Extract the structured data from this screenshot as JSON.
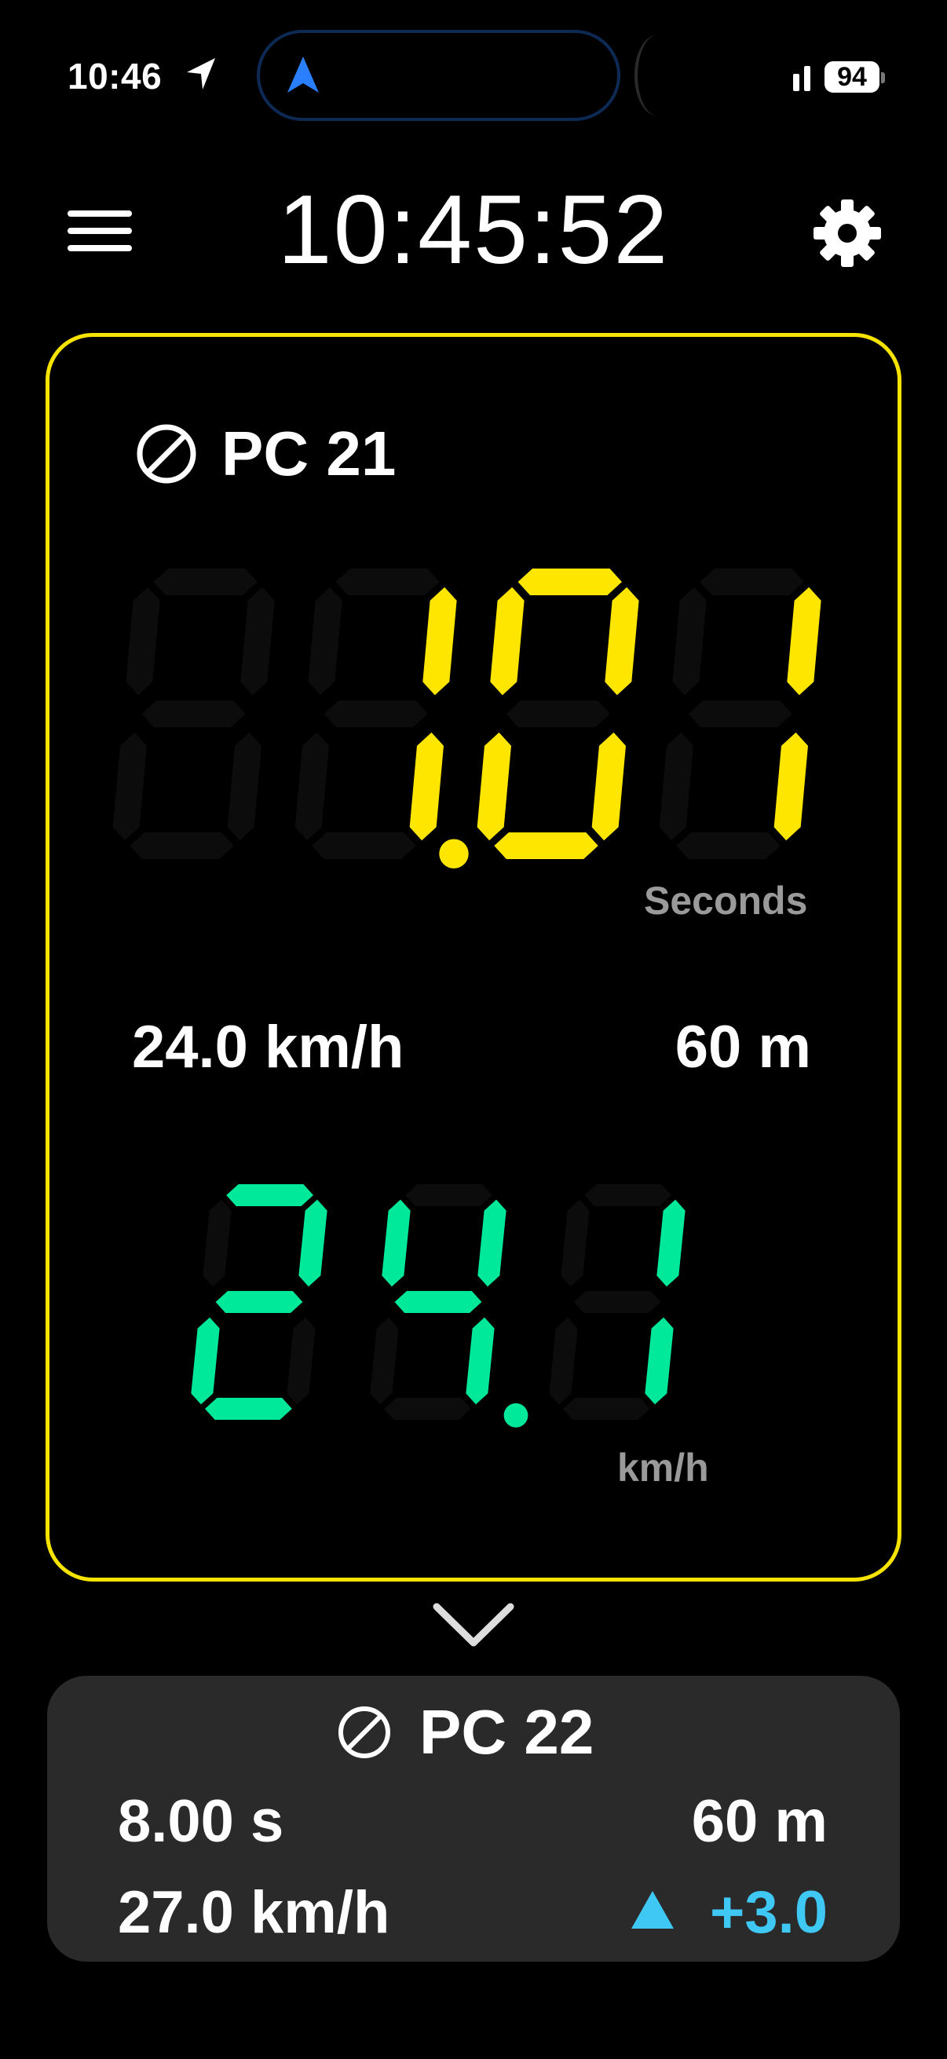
{
  "status_bar": {
    "time": "10:46",
    "battery": "94",
    "accent": "#1a73e8"
  },
  "header": {
    "clock": "10:45:52"
  },
  "current": {
    "checkpoint": "PC 21",
    "time_display": "1.01",
    "time_unit": "Seconds",
    "target_speed": "24.0 km/h",
    "target_distance": "60 m",
    "speed_display": "24.1",
    "speed_unit": "km/h",
    "border_color": "#f7e300",
    "time_color": "#ffe600",
    "speed_color": "#00e89a"
  },
  "next": {
    "checkpoint": "PC 22",
    "time": "8.00 s",
    "distance": "60 m",
    "speed": "27.0 km/h",
    "delta": "+3.0",
    "delta_color": "#3fc8f4"
  }
}
